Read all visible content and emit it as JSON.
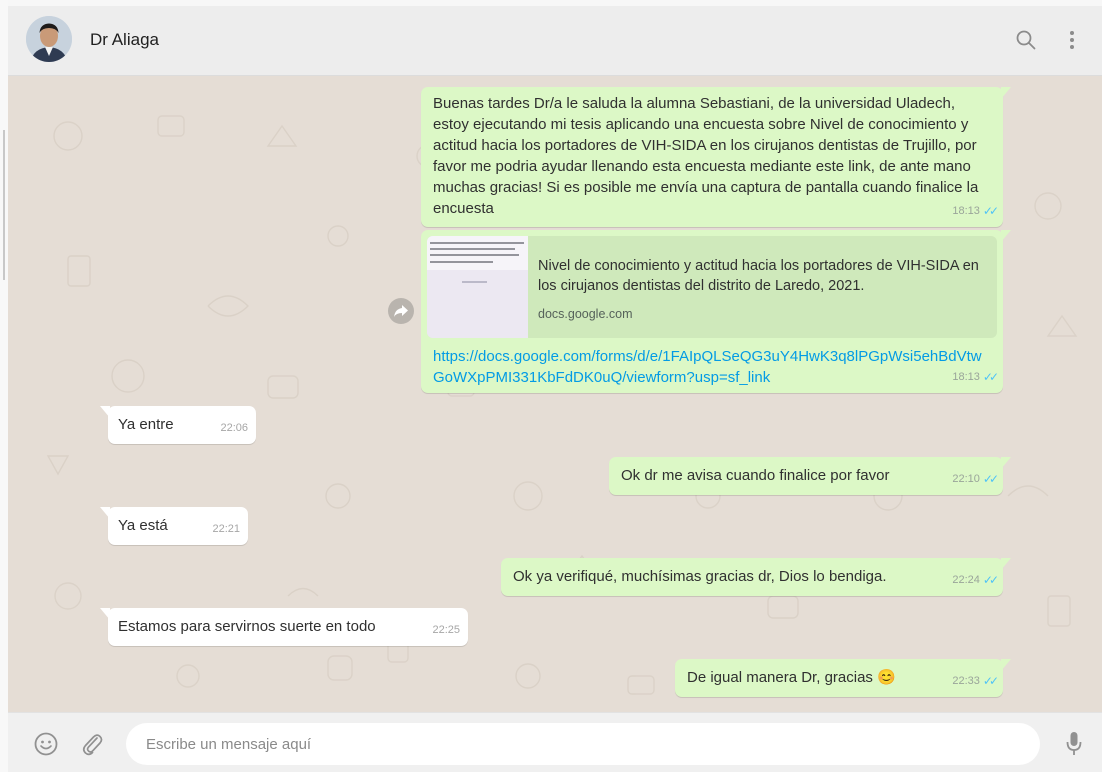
{
  "header": {
    "contact_name": "Dr Aliaga"
  },
  "messages": [
    {
      "direction": "out",
      "text": "Buenas tardes Dr/a le saluda la alumna Sebastiani, de la universidad Uladech, estoy ejecutando mi tesis aplicando una encuesta sobre Nivel de conocimiento y actitud hacia los portadores de VIH-SIDA en los cirujanos dentistas de Trujillo, por favor me podria ayudar llenando esta encuesta mediante este link, de ante mano muchas gracias! Si es posible me envía una captura de pantalla cuando finalice la encuesta",
      "time": "18:13",
      "status": "read"
    },
    {
      "direction": "out",
      "link_preview": {
        "title": "Nivel de conocimiento y actitud hacia los portadores de VIH-SIDA en los cirujanos dentistas del distrito de Laredo, 2021.",
        "domain": "docs.google.com"
      },
      "url": "https://docs.google.com/forms/d/e/1FAIpQLSeQG3uY4HwK3q8lPGpWsi5ehBdVtwGoWXpPMI331KbFdDK0uQ/viewform?usp=sf_link",
      "time": "18:13",
      "status": "read"
    },
    {
      "direction": "in",
      "text": "Ya entre",
      "time": "22:06"
    },
    {
      "direction": "out",
      "text": "Ok dr me avisa cuando finalice por favor",
      "time": "22:10",
      "status": "read"
    },
    {
      "direction": "in",
      "text": "Ya está",
      "time": "22:21"
    },
    {
      "direction": "out",
      "text": "Ok ya verifiqué, muchísimas gracias dr, Dios lo bendiga.",
      "time": "22:24",
      "status": "read"
    },
    {
      "direction": "in",
      "text": "Estamos para servirnos suerte en todo",
      "time": "22:25"
    },
    {
      "direction": "out",
      "text": "De igual manera Dr, gracias",
      "emoji": "😊",
      "time": "22:33",
      "status": "read"
    }
  ],
  "composer": {
    "placeholder": "Escribe un mensaje aquí"
  },
  "icons": {
    "search": "search-icon",
    "menu": "menu-dots-icon",
    "emoji": "emoji-icon",
    "attach": "paperclip-icon",
    "mic": "microphone-icon",
    "forward": "forward-icon",
    "read_receipt": "double-check-icon"
  },
  "colors": {
    "chat_background": "#e5ddd5",
    "outgoing_bubble": "#dcf8c6",
    "incoming_bubble": "#ffffff",
    "read_ticks": "#4fc3f7",
    "link": "#039be5",
    "header": "#ededed"
  }
}
